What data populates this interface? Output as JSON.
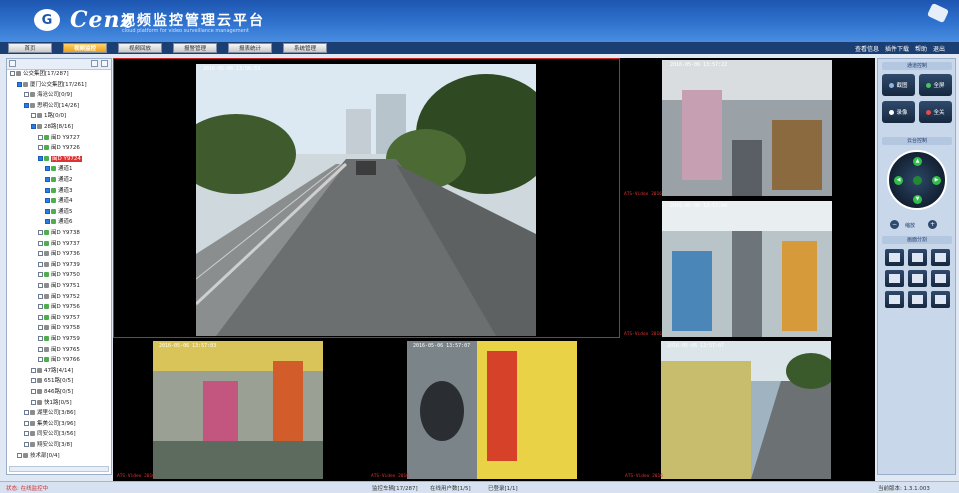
{
  "header": {
    "brand_en": "Cenz",
    "brand_cn": "视频监控管理云平台",
    "brand_sub": "cloud platform for video surveillance management"
  },
  "nav": {
    "tabs": [
      {
        "label": "首页"
      },
      {
        "label": "视频监控"
      },
      {
        "label": "视频回放"
      },
      {
        "label": "报警管理"
      },
      {
        "label": "报表统计"
      },
      {
        "label": "系统管理"
      }
    ],
    "active_index": 1,
    "links": [
      "查看信息",
      "插件下载",
      "帮助",
      "退出"
    ]
  },
  "tree": {
    "rows": [
      {
        "label": "公交集团[17/287]",
        "indent": 0,
        "checked": false,
        "icon": "grey"
      },
      {
        "label": "厦门公交集团[17/261]",
        "indent": 1,
        "checked": true,
        "icon": "grey"
      },
      {
        "label": "海沧公司[0/9]",
        "indent": 2,
        "checked": false,
        "icon": "grey"
      },
      {
        "label": "思明公司[14/26]",
        "indent": 2,
        "checked": true,
        "icon": "grey"
      },
      {
        "label": "1路[0/0]",
        "indent": 3,
        "checked": false,
        "icon": "grey"
      },
      {
        "label": "28路[8/16]",
        "indent": 3,
        "checked": true,
        "icon": "grey"
      },
      {
        "label": "闽D Y9727",
        "indent": 4,
        "checked": false,
        "icon": "green"
      },
      {
        "label": "闽D Y9726",
        "indent": 4,
        "checked": false,
        "icon": "green"
      },
      {
        "label": "闽D Y9724",
        "indent": 4,
        "checked": true,
        "icon": "green",
        "selected": true
      },
      {
        "label": "通道1",
        "indent": 5,
        "checked": true,
        "icon": "green"
      },
      {
        "label": "通道2",
        "indent": 5,
        "checked": true,
        "icon": "green"
      },
      {
        "label": "通道3",
        "indent": 5,
        "checked": true,
        "icon": "green"
      },
      {
        "label": "通道4",
        "indent": 5,
        "checked": true,
        "icon": "green"
      },
      {
        "label": "通道5",
        "indent": 5,
        "checked": true,
        "icon": "green"
      },
      {
        "label": "通道6",
        "indent": 5,
        "checked": true,
        "icon": "green"
      },
      {
        "label": "闽D Y9738",
        "indent": 4,
        "checked": false,
        "icon": "green"
      },
      {
        "label": "闽D Y9737",
        "indent": 4,
        "checked": false,
        "icon": "green"
      },
      {
        "label": "闽D Y9736",
        "indent": 4,
        "checked": false,
        "icon": "grey"
      },
      {
        "label": "闽D Y9739",
        "indent": 4,
        "checked": false,
        "icon": "grey"
      },
      {
        "label": "闽D Y9750",
        "indent": 4,
        "checked": false,
        "icon": "green"
      },
      {
        "label": "闽D Y9751",
        "indent": 4,
        "checked": false,
        "icon": "grey"
      },
      {
        "label": "闽D Y9752",
        "indent": 4,
        "checked": false,
        "icon": "grey"
      },
      {
        "label": "闽D Y9756",
        "indent": 4,
        "checked": false,
        "icon": "green"
      },
      {
        "label": "闽D Y9757",
        "indent": 4,
        "checked": false,
        "icon": "green"
      },
      {
        "label": "闽D Y9758",
        "indent": 4,
        "checked": false,
        "icon": "grey"
      },
      {
        "label": "闽D Y9759",
        "indent": 4,
        "checked": false,
        "icon": "green"
      },
      {
        "label": "闽D Y9765",
        "indent": 4,
        "checked": false,
        "icon": "grey"
      },
      {
        "label": "闽D Y9766",
        "indent": 4,
        "checked": false,
        "icon": "green"
      },
      {
        "label": "47路[4/14]",
        "indent": 3,
        "checked": false,
        "icon": "grey"
      },
      {
        "label": "651路[0/5]",
        "indent": 3,
        "checked": false,
        "icon": "grey"
      },
      {
        "label": "846路[0/5]",
        "indent": 3,
        "checked": false,
        "icon": "grey"
      },
      {
        "label": "快1路[0/5]",
        "indent": 3,
        "checked": false,
        "icon": "grey"
      },
      {
        "label": "湖里公司[3/86]",
        "indent": 2,
        "checked": false,
        "icon": "grey"
      },
      {
        "label": "集美公司[3/96]",
        "indent": 2,
        "checked": false,
        "icon": "grey"
      },
      {
        "label": "同安公司[3/56]",
        "indent": 2,
        "checked": false,
        "icon": "grey"
      },
      {
        "label": "翔安公司[3/8]",
        "indent": 2,
        "checked": false,
        "icon": "grey"
      },
      {
        "label": "技术部[0/4]",
        "indent": 1,
        "checked": false,
        "icon": "grey"
      }
    ]
  },
  "videos": {
    "main_osd_time": "2016-05-06 13:56:53",
    "cells": [
      {
        "osd": "2016-05-06 13:57:22",
        "label": "ATS-Video 2016"
      },
      {
        "osd": "2016-05-06 13:57:04",
        "label": "ATS-Video 2016"
      },
      {
        "osd": "2016-05-06 13:57:03",
        "label": "ATS-Video 2016"
      },
      {
        "osd": "2016-05-06 13:57:07",
        "label": "ATS-Video 2016"
      },
      {
        "osd": "2016-05-06 13:57:07",
        "label": "ATS-Video 2016"
      },
      {
        "osd": "2016-05-06 13:57:07",
        "label": "ATS-Video 2016"
      }
    ]
  },
  "right_panel": {
    "section1_title": "通道控制",
    "buttons": [
      "截图",
      "全屏",
      "录像",
      "全关"
    ],
    "section2_title": "云台控制",
    "zoom_label": "缩放",
    "section3_title": "画面分割"
  },
  "status": {
    "left": "状态: 在线监控中",
    "mid1": "监控车辆[17/287]",
    "mid2": "在线用户数[1/5]",
    "mid3": "已登录[1/1]",
    "right": "当前版本: 1.3.1.003"
  },
  "colors": {
    "header": "#2f73cf",
    "active_tab": "#ef9f17",
    "selected_cell_border": "#c82323"
  }
}
